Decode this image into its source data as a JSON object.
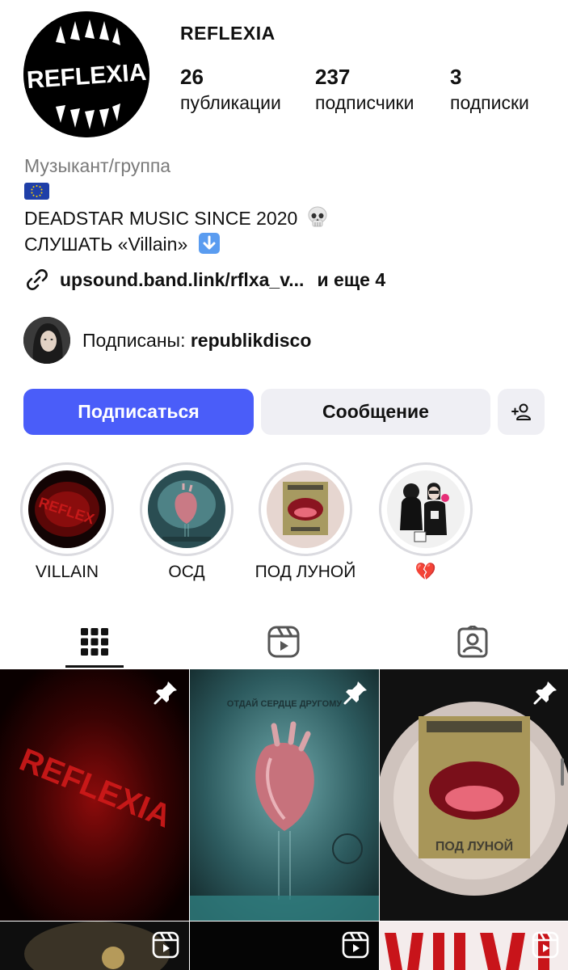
{
  "profile": {
    "username": "REFLEXIA",
    "logo_text": "REFLEXIA",
    "stats": [
      {
        "count": "26",
        "label": "публикации"
      },
      {
        "count": "237",
        "label": "подписчики"
      },
      {
        "count": "3",
        "label": "подписки"
      }
    ],
    "category": "Музыкант/группа",
    "bio_line_1": "DEADSTAR MUSIC SINCE 2020",
    "bio_line_2": "СЛУШАТЬ «Villain»",
    "link_text": "upsound.band.link/rflxa_v...",
    "link_more": "и еще 4",
    "followed_by_prefix": "Подписаны:",
    "followed_by_user": "republikdisco"
  },
  "actions": {
    "follow_label": "Подписаться",
    "message_label": "Сообщение"
  },
  "highlights": [
    {
      "label": "VILLAIN"
    },
    {
      "label": "ОСД"
    },
    {
      "label": "ПОД ЛУНОЙ"
    },
    {
      "label": "💔"
    }
  ],
  "tabs": {
    "active": "grid",
    "items": [
      "grid-icon",
      "reels-icon",
      "tagged-icon"
    ]
  },
  "posts": [
    {
      "pinned": true,
      "type": "photo",
      "image_text": "REFLEXIA"
    },
    {
      "pinned": true,
      "type": "photo",
      "image_text": "ОТДАЙ СЕРДЦЕ ДРУГОМУ"
    },
    {
      "pinned": true,
      "type": "photo",
      "image_text": "ПОД ЛУНОЙ"
    },
    {
      "pinned": false,
      "type": "reel"
    },
    {
      "pinned": false,
      "type": "reel"
    },
    {
      "pinned": false,
      "type": "reel"
    }
  ],
  "colors": {
    "accent": "#4a5df9",
    "secondary_button": "#efeff4",
    "muted_text": "#7a7a7a"
  }
}
